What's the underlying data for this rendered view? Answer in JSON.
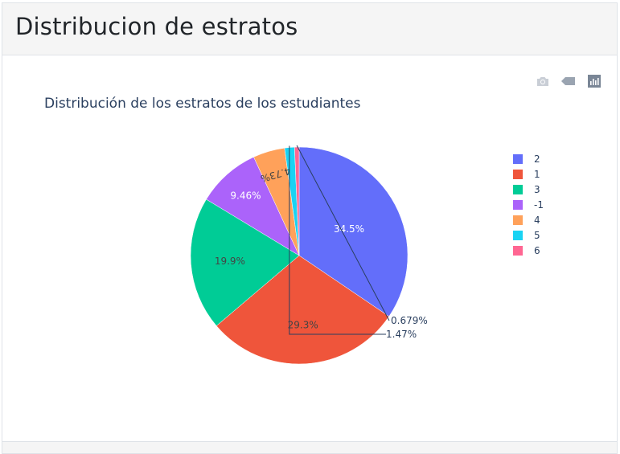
{
  "panel": {
    "title": "Distribucion de estratos"
  },
  "modebar": {
    "icons": [
      "camera-icon",
      "tag-icon",
      "bar-chart-icon"
    ]
  },
  "chart_data": {
    "type": "pie",
    "title": "Distribución de los estratos de los estudiantes",
    "labels": [
      "2",
      "1",
      "3",
      "-1",
      "4",
      "5",
      "6"
    ],
    "values": [
      34.5,
      29.3,
      19.9,
      9.46,
      4.73,
      1.47,
      0.679
    ],
    "text": [
      "34.5%",
      "29.3%",
      "19.9%",
      "9.46%",
      "4.73%",
      "1.47%",
      "0.679%"
    ],
    "colors": [
      "#636efa",
      "#EF553B",
      "#00cc96",
      "#ab63fa",
      "#FFA15A",
      "#19d3f3",
      "#FF6692"
    ],
    "legend_position": "right",
    "direction": "clockwise",
    "start": "top"
  }
}
